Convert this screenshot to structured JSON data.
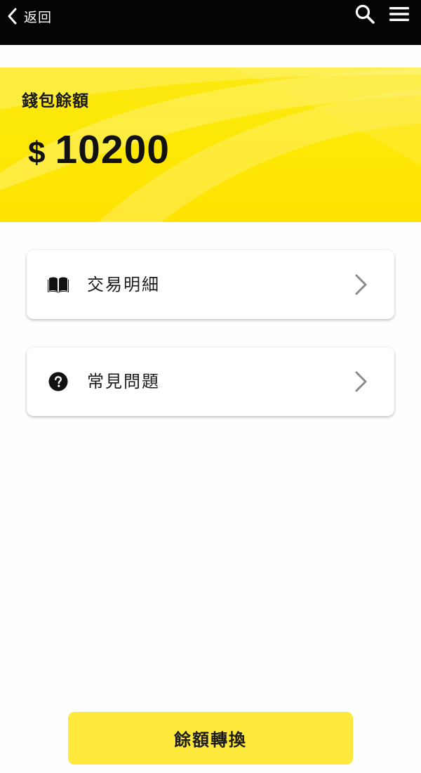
{
  "header": {
    "back_label": "返回",
    "icons": [
      "chevron-left-icon",
      "search-icon",
      "menu-icon"
    ]
  },
  "wallet": {
    "title": "錢包餘額",
    "currency": "$",
    "balance": "10200",
    "accent_color": "#ffe500"
  },
  "menu": {
    "items": [
      {
        "label": "交易明細",
        "icon": "book-icon"
      },
      {
        "label": "常見問題",
        "icon": "question-circle-icon"
      }
    ]
  },
  "footer": {
    "convert_label": "餘額轉換",
    "button_color": "#ffe93d"
  }
}
